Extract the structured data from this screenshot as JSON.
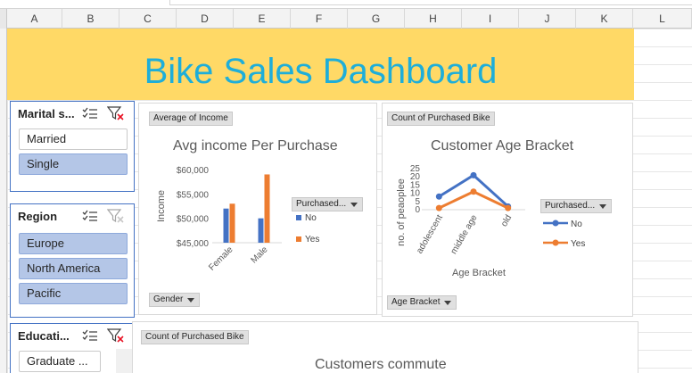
{
  "sheet": {
    "columns": [
      "A",
      "B",
      "C",
      "D",
      "E",
      "F",
      "G",
      "H",
      "I",
      "J",
      "K",
      "L"
    ]
  },
  "dashboard": {
    "title": "Bike Sales Dashboard",
    "title_color": "#1eaed9",
    "band_color": "#ffd966"
  },
  "slicers": {
    "marital": {
      "header": "Marital s...",
      "items": [
        {
          "label": "Married",
          "selected": false
        },
        {
          "label": "Single",
          "selected": true
        }
      ]
    },
    "region": {
      "header": "Region",
      "items": [
        {
          "label": "Europe",
          "selected": true
        },
        {
          "label": "North America",
          "selected": true
        },
        {
          "label": "Pacific",
          "selected": true
        }
      ]
    },
    "education": {
      "header": "Educati...",
      "items": [
        {
          "label": "Graduate ...",
          "selected": false
        }
      ]
    }
  },
  "charts": {
    "income": {
      "value_field": "Average of Income",
      "axis_field": "Gender",
      "legend_field": "Purchased...",
      "colors": {
        "No": "#4472c4",
        "Yes": "#ed7d31"
      }
    },
    "age": {
      "value_field": "Count of Purchased Bike",
      "axis_field": "Age Bracket",
      "legend_field": "Purchased...",
      "colors": {
        "No": "#4472c4",
        "Yes": "#ed7d31"
      }
    },
    "commute": {
      "value_field": "Count of Purchased Bike",
      "title": "Customers commute"
    }
  },
  "chart_data": [
    {
      "type": "bar",
      "title": "Avg income Per Purchase",
      "xlabel": "",
      "ylabel": "Income",
      "categories": [
        "Female",
        "Male"
      ],
      "series": [
        {
          "name": "No",
          "values": [
            52000,
            50000
          ]
        },
        {
          "name": "Yes",
          "values": [
            53000,
            59000
          ]
        }
      ],
      "ylim": [
        45000,
        60000
      ],
      "yticks": [
        "$45,000",
        "$50,000",
        "$55,000",
        "$60,000"
      ],
      "legend": "right",
      "grid": false
    },
    {
      "type": "line",
      "title": "Customer Age Bracket",
      "xlabel": "Age Bracket",
      "ylabel": "no. of peaoplee",
      "categories": [
        "adolescent",
        "middle age",
        "old"
      ],
      "series": [
        {
          "name": "No",
          "values": [
            8,
            21,
            2
          ]
        },
        {
          "name": "Yes",
          "values": [
            1,
            11,
            1
          ]
        }
      ],
      "ylim": [
        0,
        25
      ],
      "yticks": [
        "0",
        "5",
        "10",
        "15",
        "20",
        "25"
      ],
      "legend": "right",
      "grid": false
    }
  ]
}
